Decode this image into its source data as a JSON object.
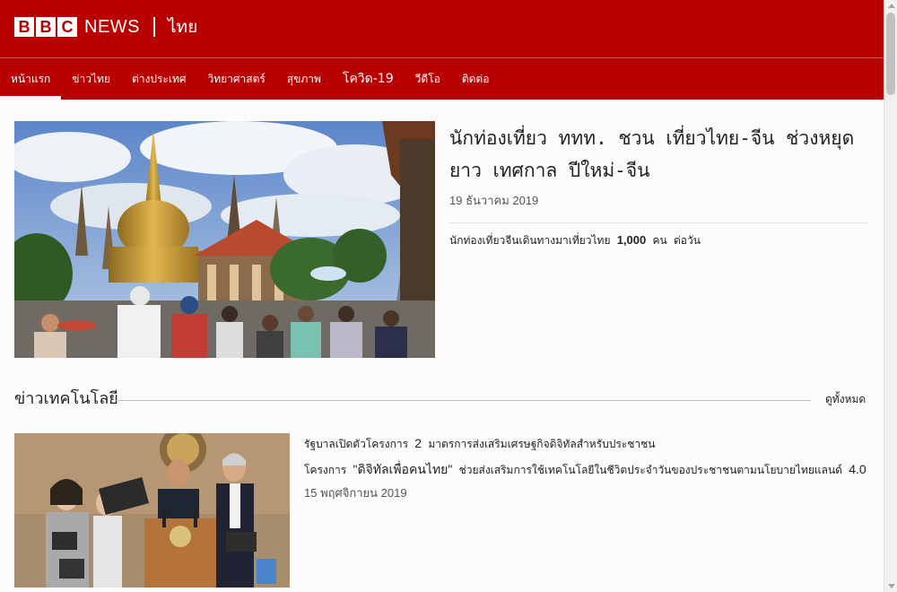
{
  "brand": {
    "letters": [
      "B",
      "B",
      "C"
    ],
    "news": "NEWS",
    "language": "ไทย",
    "color": "#b80000"
  },
  "nav": {
    "items": [
      {
        "label": "หน้าแรก",
        "active": true
      },
      {
        "label": "ข่าวไทย"
      },
      {
        "label": "ต่างประเทศ"
      },
      {
        "label": "วิทยาศาสตร์"
      },
      {
        "label": "สุขภาพ"
      },
      {
        "label": "โควิด-19"
      },
      {
        "label": "วีดีโอ"
      },
      {
        "label": "ติดต่อ"
      }
    ]
  },
  "hero": {
    "image_alt": "temple-photo",
    "title": "นักท่องเที่ยว ททท. ชวน เที่ยวไทย-จีน ช่วงหยุด ยาว เทศกาล ปีใหม่-จีน",
    "date": "19 ธันวาคม 2019",
    "summary_prefix": "นักท่องเที่ยวจีนเดินทางมาเที่ยวไทย",
    "summary_number": "1,000",
    "summary_suffix": "คน ต่อวัน"
  },
  "section": {
    "title": "ข่าวเทคโนโลยี",
    "more_link": "ดูทั้งหมด"
  },
  "story": {
    "image_alt": "press-conference-photo",
    "title_prefix": "รัฐบาลเปิดตัวโครงการ",
    "title_number": "2",
    "title_suffix": "มาตรการส่งเสริมเศรษฐกิจดิจิทัลสำหรับประชาชน",
    "summary_prefix": "โครงการ",
    "summary_quote": "\"ดิจิทัลเพื่อคนไทย\"",
    "summary_body": "ช่วยส่งเสริมการใช้เทคโนโลยีในชีวิตประจำวันของประชาชนตามนโยบายไทยแลนด์",
    "summary_number": "4.0",
    "date": "15 พฤศจิกายน 2019"
  }
}
